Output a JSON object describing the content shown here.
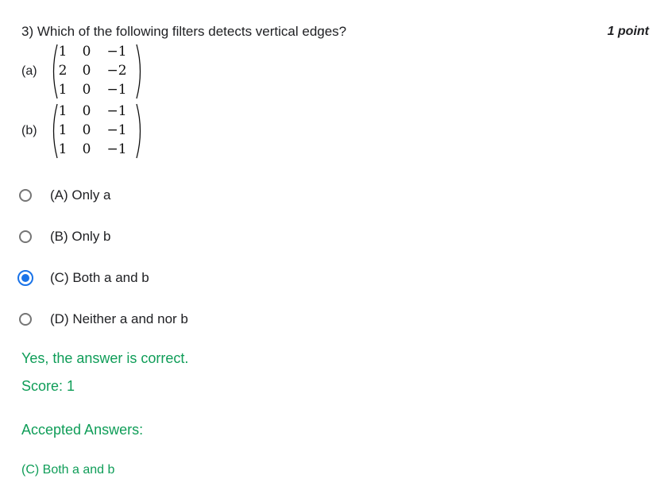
{
  "question": {
    "text": "3) Which of the following filters detects vertical edges?",
    "points": "1 point"
  },
  "filters": [
    {
      "label": "(a)",
      "rows": [
        [
          "1",
          "0",
          "−1"
        ],
        [
          "2",
          "0",
          "−2"
        ],
        [
          "1",
          "0",
          "−1"
        ]
      ]
    },
    {
      "label": "(b)",
      "rows": [
        [
          "1",
          "0",
          "−1"
        ],
        [
          "1",
          "0",
          "−1"
        ],
        [
          "1",
          "0",
          "−1"
        ]
      ]
    }
  ],
  "options": [
    {
      "label": "(A) Only a",
      "selected": false
    },
    {
      "label": "(B) Only b",
      "selected": false
    },
    {
      "label": "(C) Both a and b",
      "selected": true
    },
    {
      "label": "(D) Neither a and nor b",
      "selected": false
    }
  ],
  "feedback": {
    "result": "Yes, the answer is correct.",
    "score": "Score: 1",
    "accepted_title": "Accepted Answers:",
    "accepted_value": "(C) Both a and b"
  },
  "colors": {
    "accent": "#1a73e8",
    "correct": "#0f9d58"
  }
}
